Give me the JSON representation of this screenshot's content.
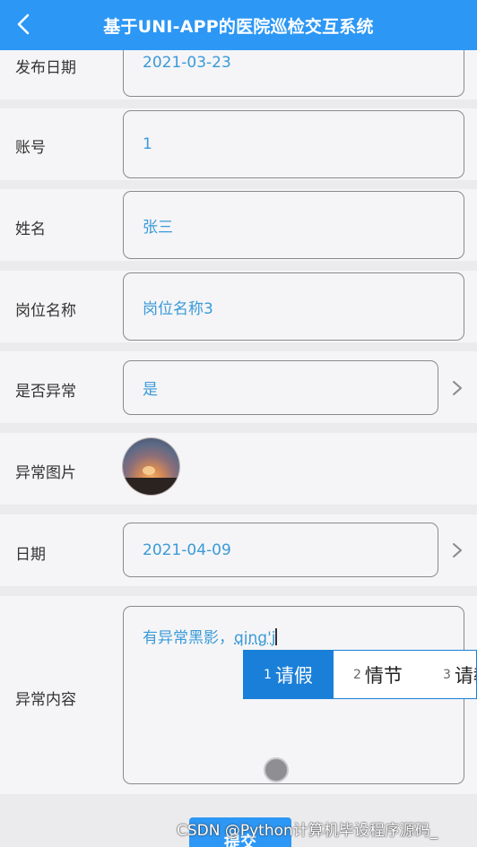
{
  "header": {
    "title": "基于UNI-APP的医院巡检交互系统",
    "back_icon": "chevron-left-icon",
    "color": "#2c97f5"
  },
  "form": {
    "publish_date": {
      "label": "发布日期",
      "value": "2021-03-23"
    },
    "account": {
      "label": "账号",
      "value": "1"
    },
    "name": {
      "label": "姓名",
      "value": "张三"
    },
    "position_name": {
      "label": "岗位名称",
      "value": "岗位名称3"
    },
    "abnormal": {
      "label": "是否异常",
      "value": "是",
      "icon": "chevron-right-icon"
    },
    "abnormal_image": {
      "label": "异常图片"
    },
    "date": {
      "label": "日期",
      "value": "2021-04-09",
      "icon": "chevron-right-icon"
    },
    "abnormal_content": {
      "label": "异常内容",
      "value": "有异常黑影，",
      "composing": "qing'j"
    }
  },
  "ime": {
    "candidates": [
      {
        "num": "1",
        "text": "请假",
        "selected": true
      },
      {
        "num": "2",
        "text": "情节",
        "selected": false
      },
      {
        "num": "3",
        "text": "请教",
        "selected": false
      }
    ]
  },
  "submit_label": "提交",
  "watermark": "CSDN @Python计算机毕设程序源码_"
}
